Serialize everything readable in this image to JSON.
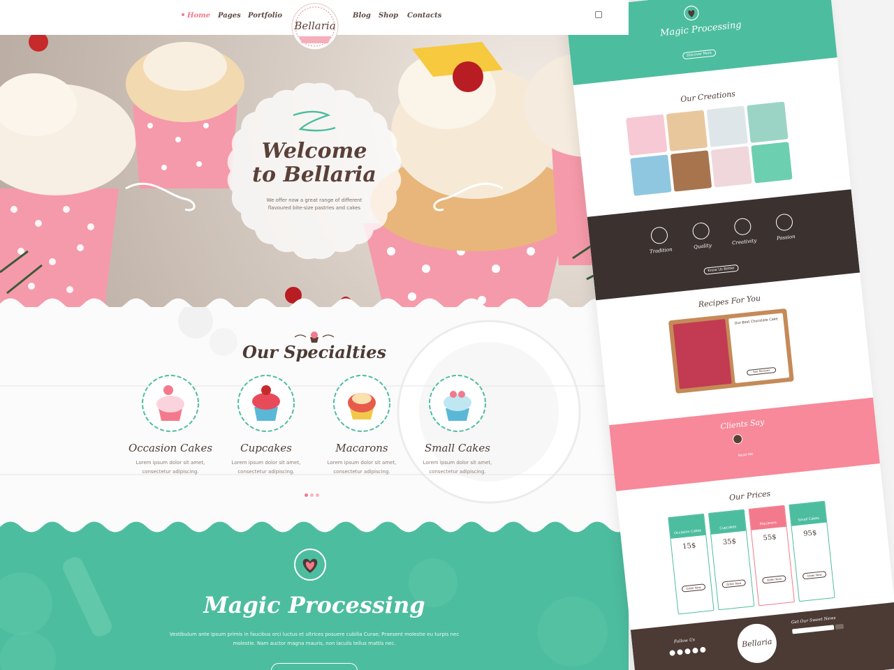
{
  "nav": {
    "items": [
      {
        "label": "Home",
        "active": true
      },
      {
        "label": "Pages"
      },
      {
        "label": "Portfolio"
      },
      {
        "label": "Blog"
      },
      {
        "label": "Shop"
      },
      {
        "label": "Contacts"
      }
    ],
    "logo_text": "Bellaria"
  },
  "hero": {
    "title_line1": "Welcome",
    "title_line2": "to Bellaria",
    "subtitle_line1": "We offer now a great range of different",
    "subtitle_line2": "flavoured bite-size pastries and cakes"
  },
  "specialties": {
    "title": "Our Specialties",
    "items": [
      {
        "name": "Occasion Cakes",
        "desc1": "Lorem ipsum dolor sit amet,",
        "desc2": "consectetur adipiscing."
      },
      {
        "name": "Cupcakes",
        "desc1": "Lorem ipsum dolor sit amet,",
        "desc2": "consectetur adipiscing."
      },
      {
        "name": "Macarons",
        "desc1": "Lorem ipsum dolor sit amet,",
        "desc2": "consectetur adipiscing."
      },
      {
        "name": "Small Cakes",
        "desc1": "Lorem ipsum dolor sit amet,",
        "desc2": "consectetur adipiscing."
      }
    ]
  },
  "magic": {
    "title": "Magic Processing",
    "text_line1": "Vestibulum ante ipsum primis in faucibus orci luctus et ultrices posuere cubilia Curae; Praesent molestie eu turpis nec",
    "text_line2": "molestie. Nam auctor magna mauris, non iaculis tellus mattis nec."
  },
  "preview": {
    "magic_title": "Magic Processing",
    "magic_button": "Discover More",
    "creations_title": "Our Creations",
    "features": [
      {
        "name": "Tradition"
      },
      {
        "name": "Quality"
      },
      {
        "name": "Creativity"
      },
      {
        "name": "Passion"
      }
    ],
    "features_button": "Know Us Better",
    "recipes_title": "Recipes For You",
    "recipe_name": "Our Best Chocolate Cake",
    "recipe_button": "See Recipes",
    "clients_title": "Clients Say",
    "clients_name": "Read Me",
    "prices_title": "Our Prices",
    "prices": [
      {
        "name": "Occasion Cakes",
        "price": "15$",
        "button": "Order Now"
      },
      {
        "name": "Cupcakes",
        "price": "35$",
        "button": "Order Now"
      },
      {
        "name": "Macarons",
        "price": "55$",
        "button": "Order Now"
      },
      {
        "name": "Small Cakes",
        "price": "95$",
        "button": "Order Now"
      }
    ],
    "follow_label": "Follow Us",
    "newsletter_label": "Get Our Sweet News",
    "footer_logo": "Bellaria"
  },
  "colors": {
    "mint": "#4dbd9f",
    "pink": "#f27a8c",
    "brown": "#4c3a34",
    "cream": "#fbfbfb"
  }
}
